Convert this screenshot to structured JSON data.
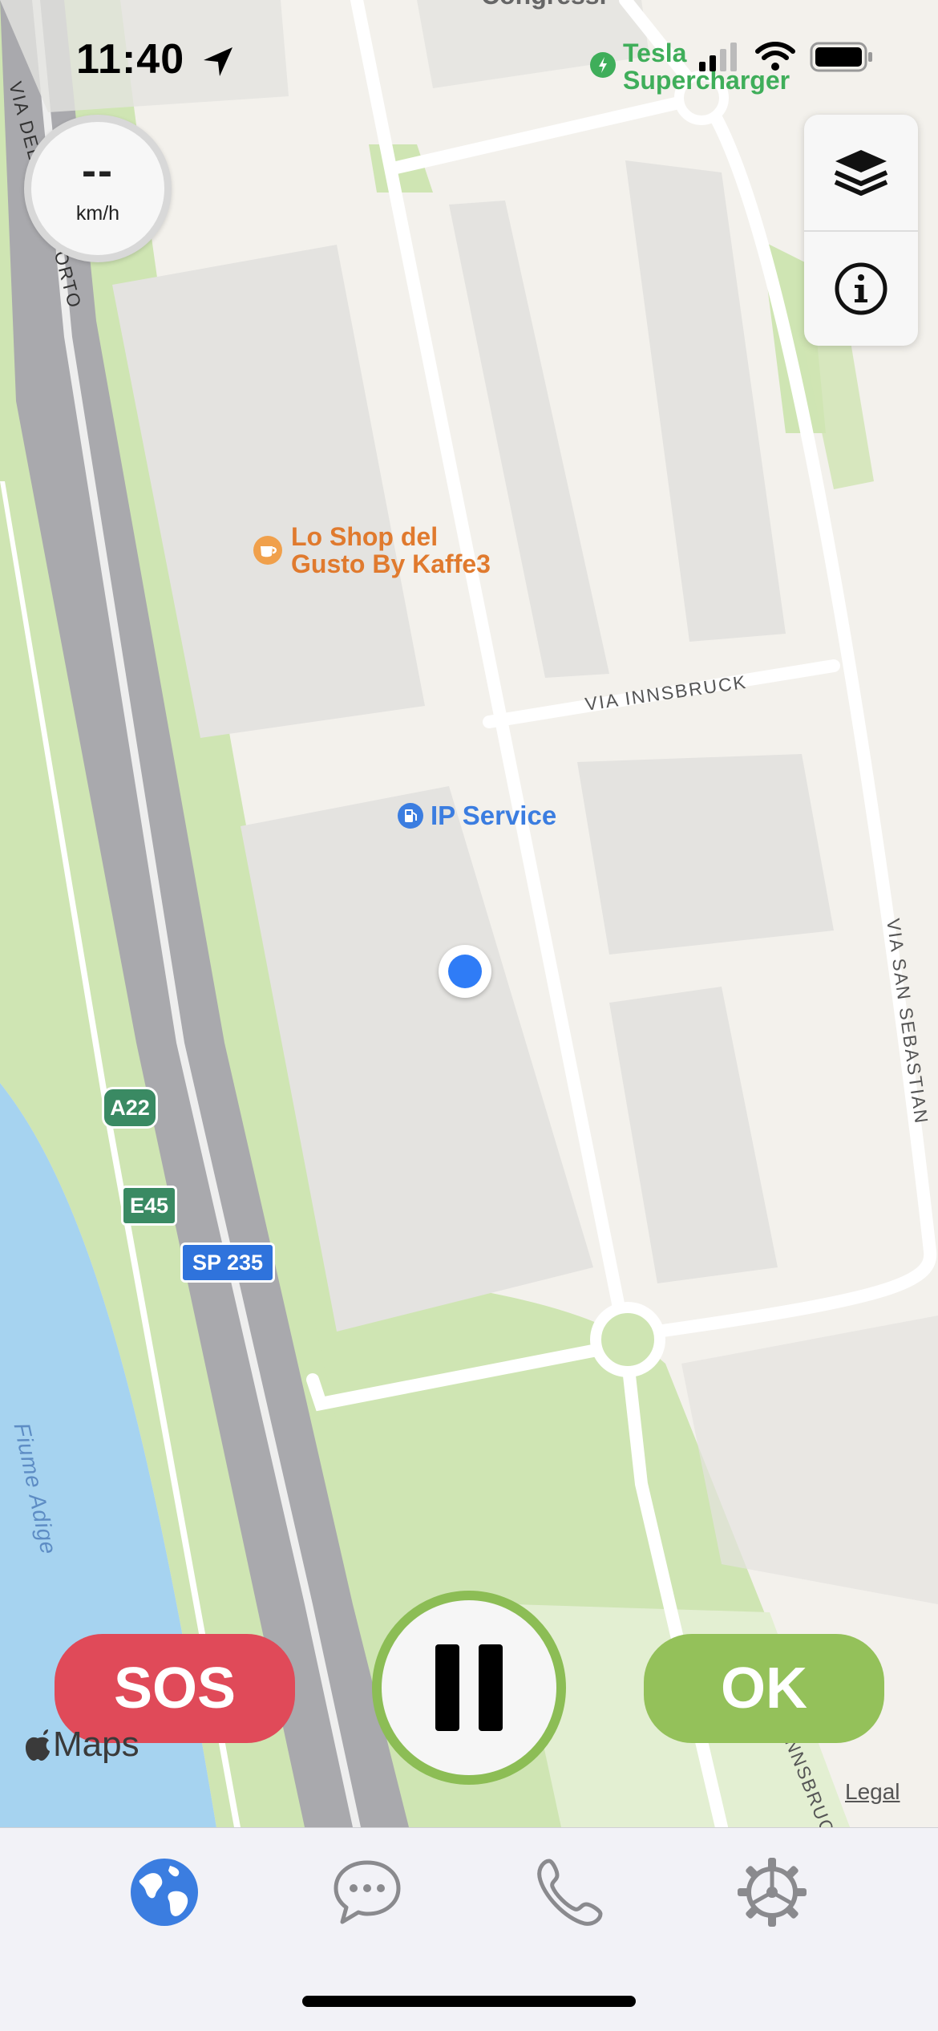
{
  "status_bar": {
    "time": "11:40"
  },
  "speed": {
    "value": "--",
    "unit": "km/h"
  },
  "map": {
    "pois": [
      {
        "name": "Tesla Supercharger",
        "color": "#3fae5a"
      },
      {
        "name": "Lo Shop del Gusto By Kaffe3",
        "line1": "Lo Shop del",
        "line2": "Gusto By Kaffe3",
        "color": "#e07a2e"
      },
      {
        "name": "IP Service",
        "color": "#3b7de0"
      },
      {
        "name": "Congressi",
        "color": "#555555"
      }
    ],
    "roads": {
      "via_innsbruck": "VIA INNSBRUCK",
      "via_san_sebastian": "VIA SAN SEBASTIAN",
      "via_interporto": "VIA DELL'INTERPORTO",
      "innsbruck_bottom": "INNSBRUC"
    },
    "shields": {
      "a22": "A22",
      "e45": "E45",
      "sp235": "SP 235"
    },
    "water": "Fiume Adige",
    "attribution": {
      "maps": "Maps",
      "legal": "Legal"
    }
  },
  "actions": {
    "sos": "SOS",
    "ok": "OK"
  },
  "tabs": [
    "map",
    "messages",
    "call",
    "settings"
  ],
  "colors": {
    "sos": "#e04a59",
    "ok": "#94c15a",
    "accent": "#3b7de0"
  }
}
